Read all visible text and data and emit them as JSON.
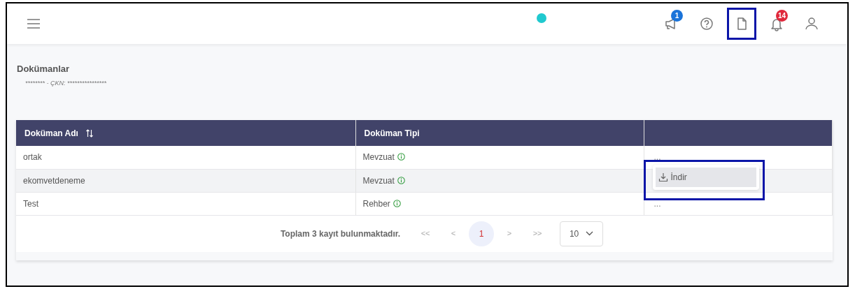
{
  "header": {
    "actions": [
      {
        "kind": "announce",
        "badge": "1",
        "highlighted": false
      },
      {
        "kind": "help",
        "highlighted": false
      },
      {
        "kind": "document",
        "highlighted": true
      },
      {
        "kind": "bell",
        "badge": "14",
        "highlighted": false
      },
      {
        "kind": "user",
        "highlighted": false
      }
    ]
  },
  "page": {
    "title": "Dokümanlar",
    "subtitle_prefix": "********",
    "subtitle_label": "- ÇKN:",
    "subtitle_value": "****************"
  },
  "table": {
    "columns": [
      {
        "label": "Doküman Adı",
        "sortable": true
      },
      {
        "label": "Doküman Tipi",
        "sortable": false
      },
      {}
    ],
    "rows": [
      {
        "name": "ortak",
        "type": "Mevzuat",
        "more": "..."
      },
      {
        "name": "ekomvetdeneme",
        "type": "Mevzuat",
        "menu": [
          {
            "label": "İndir",
            "hovered": true,
            "highlighted": true
          }
        ]
      },
      {
        "name": "Test",
        "type": "Rehber",
        "more": "..."
      }
    ]
  },
  "pagination": {
    "summary": "Toplam 3 kayıt bulunmaktadır.",
    "first": "<<",
    "prev": "<",
    "pages": [
      {
        "label": "1",
        "selected": true
      }
    ],
    "next": ">",
    "last": ">>",
    "page_size": "10"
  }
}
